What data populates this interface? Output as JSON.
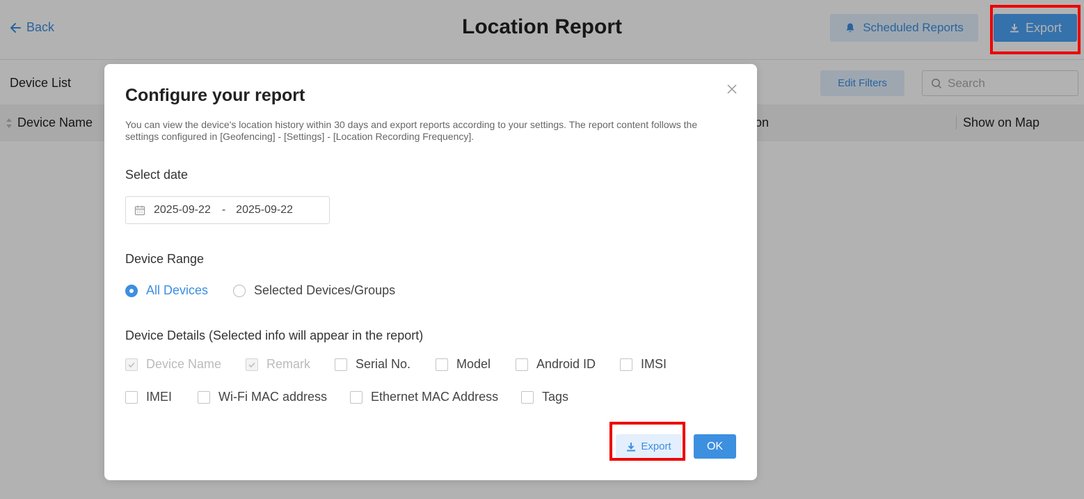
{
  "header": {
    "back_label": "Back",
    "title": "Location Report",
    "scheduled_reports_label": "Scheduled Reports",
    "export_label": "Export"
  },
  "toolbar": {
    "device_list_label": "Device List",
    "edit_filters_label": "Edit Filters",
    "search_placeholder": "Search"
  },
  "table": {
    "columns": [
      "Device Name",
      "on",
      "Show on Map"
    ]
  },
  "modal": {
    "title": "Configure your report",
    "description": "You can view the device's location history within 30 days and export reports according to your settings. The report content follows the settings configured in [Geofencing] - [Settings] - [Location Recording Frequency].",
    "select_date_label": "Select date",
    "date_start": "2025-09-22",
    "date_separator": "-",
    "date_end": "2025-09-22",
    "device_range_label": "Device Range",
    "range_options": [
      {
        "label": "All Devices",
        "selected": true
      },
      {
        "label": "Selected Devices/Groups",
        "selected": false
      }
    ],
    "details_label": "Device Details (Selected info will appear in the report)",
    "details": [
      {
        "label": "Device Name",
        "checked": true,
        "disabled": true
      },
      {
        "label": "Remark",
        "checked": true,
        "disabled": true
      },
      {
        "label": "Serial No.",
        "checked": false,
        "disabled": false
      },
      {
        "label": "Model",
        "checked": false,
        "disabled": false
      },
      {
        "label": "Android ID",
        "checked": false,
        "disabled": false
      },
      {
        "label": "IMSI",
        "checked": false,
        "disabled": false
      },
      {
        "label": "IMEI",
        "checked": false,
        "disabled": false
      },
      {
        "label": "Wi-Fi MAC address",
        "checked": false,
        "disabled": false
      },
      {
        "label": "Ethernet MAC Address",
        "checked": false,
        "disabled": false
      },
      {
        "label": "Tags",
        "checked": false,
        "disabled": false
      }
    ],
    "export_label": "Export",
    "ok_label": "OK"
  },
  "colors": {
    "accent": "#3d8fe0",
    "highlight": "#ee0000"
  }
}
